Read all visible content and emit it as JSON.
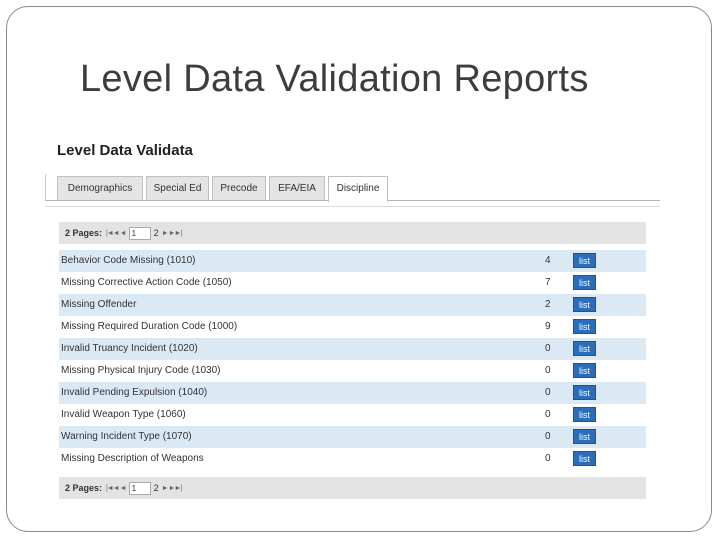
{
  "slide": {
    "title": "Level Data Validation Reports"
  },
  "app": {
    "heading": "Level Data Validata"
  },
  "tabs": [
    {
      "label": "Demographics"
    },
    {
      "label": "Special Ed"
    },
    {
      "label": "Precode"
    },
    {
      "label": "EFA/EIA"
    },
    {
      "label": "Discipline"
    }
  ],
  "pager_top": {
    "pages_label": "2 Pages:",
    "first_prev": "|◄◄ ◄",
    "current_page": "1",
    "total": "2",
    "next_last": "► ►►|"
  },
  "pager_bottom": {
    "pages_label": "2 Pages:",
    "first_prev": "|◄◄ ◄",
    "current_page": "1",
    "total": "2",
    "next_last": "► ►►|"
  },
  "rows": [
    {
      "label": "Behavior Code Missing (1010)",
      "count": "4",
      "action": "list"
    },
    {
      "label": "Missing Corrective Action Code (1050)",
      "count": "7",
      "action": "list"
    },
    {
      "label": "Missing Offender",
      "count": "2",
      "action": "list"
    },
    {
      "label": "Missing Required Duration Code (1000)",
      "count": "9",
      "action": "list"
    },
    {
      "label": "Invalid Truancy Incident (1020)",
      "count": "0",
      "action": "list"
    },
    {
      "label": "Missing Physical Injury Code (1030)",
      "count": "0",
      "action": "list"
    },
    {
      "label": "Invalid Pending Expulsion (1040)",
      "count": "0",
      "action": "list"
    },
    {
      "label": "Invalid Weapon Type (1060)",
      "count": "0",
      "action": "list"
    },
    {
      "label": "Warning Incident Type (1070)",
      "count": "0",
      "action": "list"
    },
    {
      "label": "Missing Description of Weapons",
      "count": "0",
      "action": "list"
    }
  ],
  "colors": {
    "row_alt": "#dbe9f5",
    "list_button": "#2a6ebb",
    "pager_bg": "#e3e3e3"
  }
}
